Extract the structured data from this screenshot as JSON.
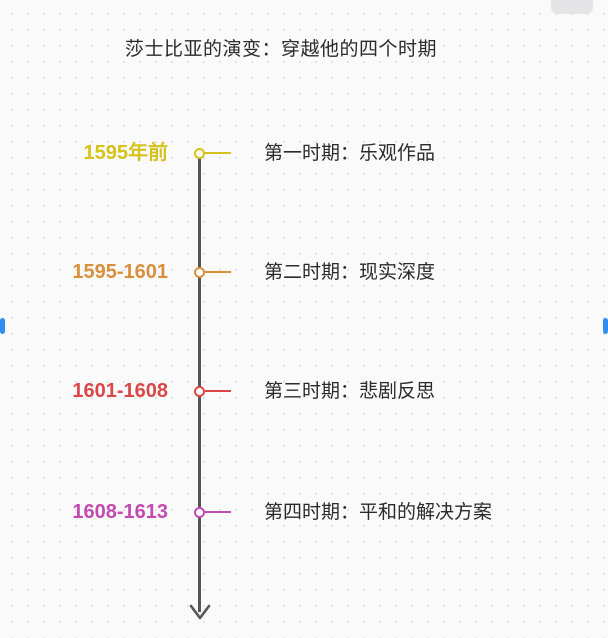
{
  "title": "莎士比亚的演变：穿越他的四个时期",
  "periods": [
    {
      "date": "1595年前",
      "label": "第一时期：乐观作品",
      "color": "#d6c21c"
    },
    {
      "date": "1595-1601",
      "label": "第二时期：现实深度",
      "color": "#d98f3c"
    },
    {
      "date": "1601-1608",
      "label": "第三时期：悲剧反思",
      "color": "#d94848"
    },
    {
      "date": "1608-1613",
      "label": "第四时期：平和的解决方案",
      "color": "#c34ab0"
    }
  ]
}
